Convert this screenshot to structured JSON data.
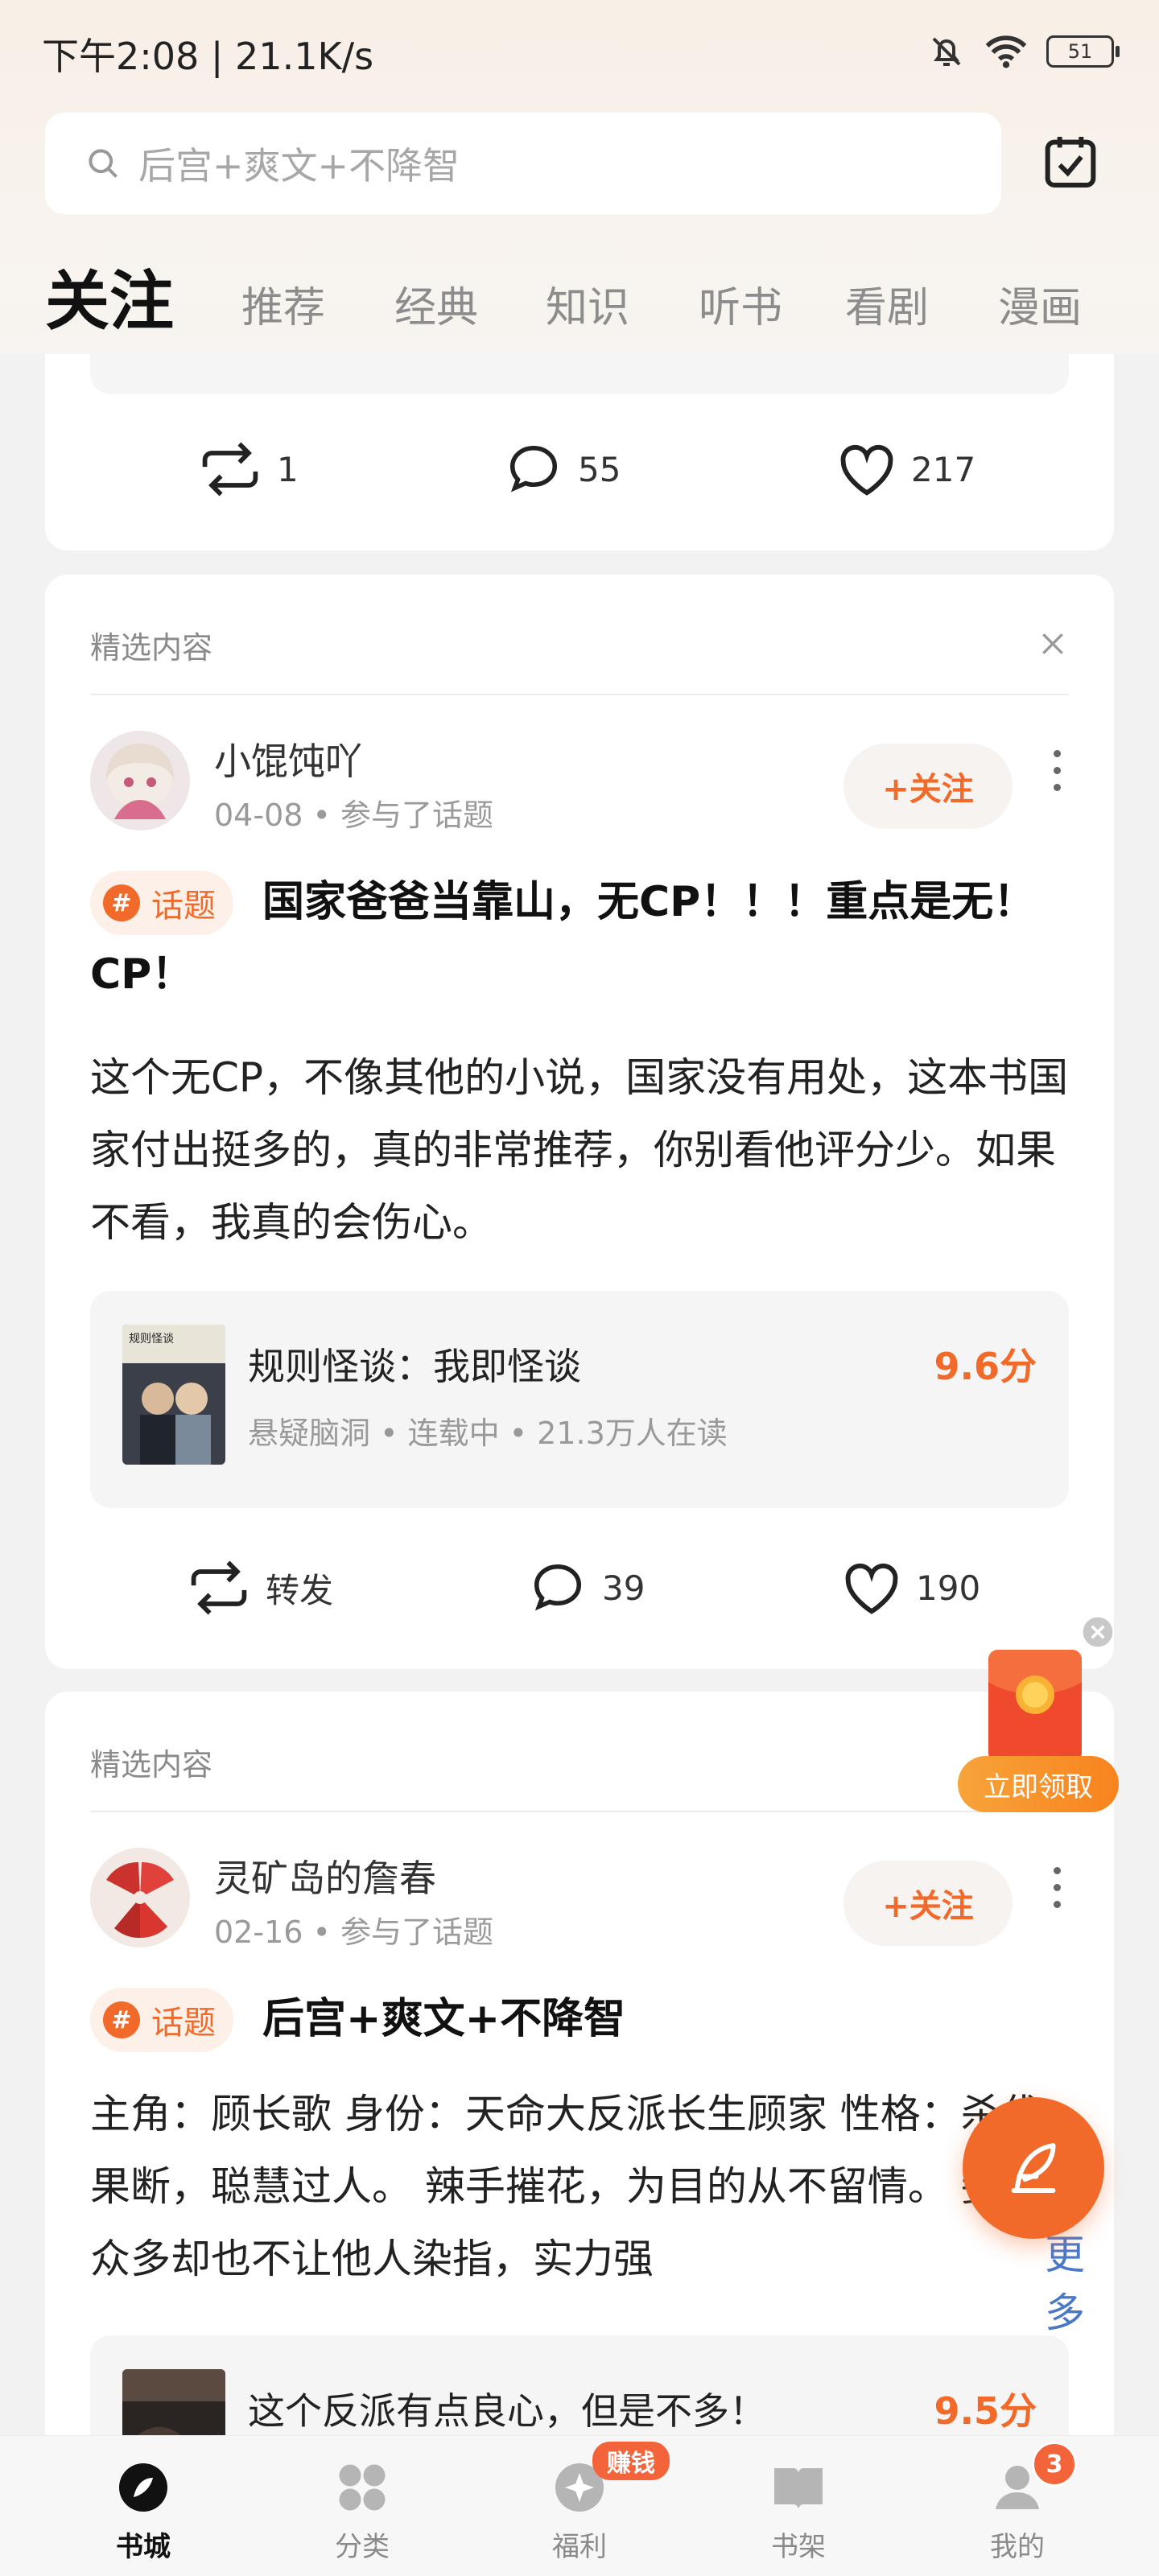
{
  "status_bar": {
    "time_speed": "下午2:08 | 21.1K/s",
    "battery": "51"
  },
  "search": {
    "placeholder": "后宫+爽文+不降智"
  },
  "tabs": [
    {
      "label": "关注",
      "active": true
    },
    {
      "label": "推荐"
    },
    {
      "label": "经典"
    },
    {
      "label": "知识"
    },
    {
      "label": "听书"
    },
    {
      "label": "看剧"
    },
    {
      "label": "漫画"
    }
  ],
  "prev_card": {
    "reposts": "1",
    "comments": "55",
    "likes": "217"
  },
  "posts": [
    {
      "section_label": "精选内容",
      "username": "小馄饨吖",
      "meta": "04-08 • 参与了话题",
      "follow": "+关注",
      "topic_badge": "话题",
      "title": "国家爸爸当靠山，无CP！！！重点是无！CP！",
      "body": "这个无CP，不像其他的小说，国家没有用处，这本书国家付出挺多的，真的非常推荐，你别看他评分少。如果不看，我真的会伤心。",
      "book": {
        "title": "规则怪谈：我即怪谈",
        "meta": "悬疑脑洞 • 连载中 • 21.3万人在读",
        "score": "9.6分"
      },
      "repost_label": "转发",
      "comments": "39",
      "likes": "190"
    },
    {
      "section_label": "精选内容",
      "username": "灵矿岛的詹春",
      "meta": "02-16 • 参与了话题",
      "follow": "+关注",
      "topic_badge": "话题",
      "title": "后宫+爽文+不降智",
      "body": "主角：顾长歌 身份：天命大反派长生顾家 性格：杀伐果断，聪慧过人。 辣手摧花，为目的从不留情。 妾侍众多却也不让他人染指，实力强",
      "more": "更多",
      "book": {
        "title": "这个反派有点良心，但是不多！",
        "score": "9.5分"
      }
    }
  ],
  "float_promo": {
    "label": "立即领取"
  },
  "bottom_nav": [
    {
      "label": "书城",
      "active": true
    },
    {
      "label": "分类"
    },
    {
      "label": "福利",
      "badge": "赚钱"
    },
    {
      "label": "书架"
    },
    {
      "label": "我的",
      "badge": "3"
    }
  ],
  "colors": {
    "accent": "#f26a2a"
  }
}
